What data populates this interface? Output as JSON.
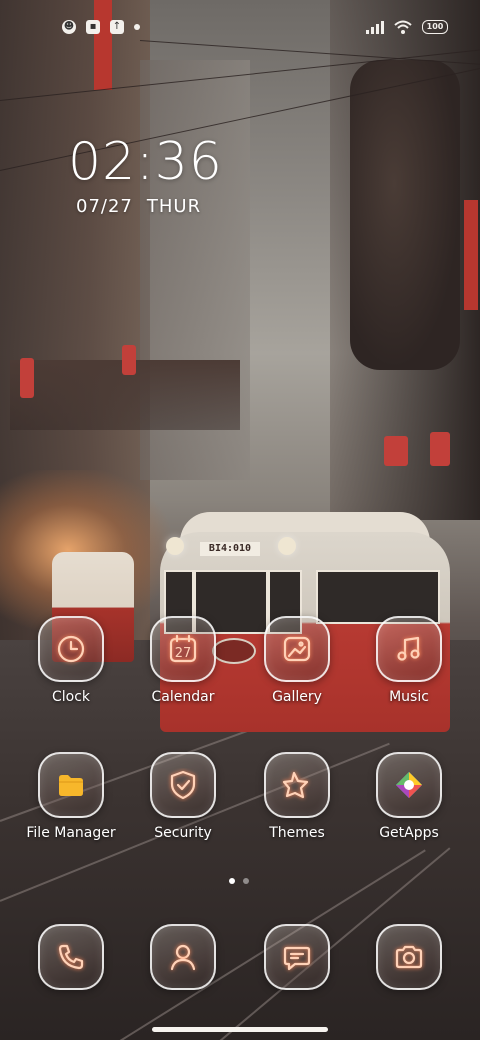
{
  "status_bar": {
    "left_icons": [
      "face-icon",
      "image-icon",
      "upload-icon",
      "dot-icon"
    ],
    "right_icons": [
      "signal-icon",
      "wifi-icon",
      "battery-icon"
    ],
    "battery": "100"
  },
  "clock": {
    "time": "02:36",
    "date": "07/27",
    "weekday": "THUR"
  },
  "tram": {
    "destination": "BI4:010"
  },
  "apps": [
    {
      "label": "Clock",
      "icon": "clock-icon"
    },
    {
      "label": "Calendar",
      "icon": "calendar-icon",
      "badge": "27"
    },
    {
      "label": "Gallery",
      "icon": "gallery-icon"
    },
    {
      "label": "Music",
      "icon": "music-icon"
    },
    {
      "label": "File Manager",
      "icon": "folder-icon"
    },
    {
      "label": "Security",
      "icon": "shield-icon"
    },
    {
      "label": "Themes",
      "icon": "star-icon"
    },
    {
      "label": "GetApps",
      "icon": "getapps-icon"
    }
  ],
  "dock": [
    {
      "icon": "phone-icon"
    },
    {
      "icon": "contacts-icon"
    },
    {
      "icon": "messages-icon"
    },
    {
      "icon": "camera-icon"
    }
  ],
  "page_indicator": {
    "count": 2,
    "active": 1
  },
  "colors": {
    "accent_glow": "#ffd2b8",
    "icon_glow": "#ff8a5a"
  }
}
